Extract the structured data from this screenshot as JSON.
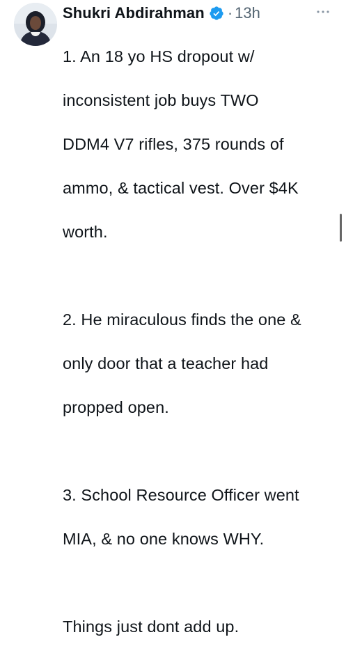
{
  "tweet": {
    "author_name": "Shukri Abdirahman",
    "verified": true,
    "verified_icon": "verified-badge-icon",
    "separator": "·",
    "timestamp": "13h",
    "more_icon": "more-dots-icon",
    "avatar_icon": "avatar-photo",
    "body_lines": [
      "1. An 18 yo HS dropout w/",
      "inconsistent job buys TWO",
      "DDM4 V7 rifles, 375 rounds of",
      "ammo, & tactical vest. Over $4K",
      "worth.",
      "",
      "2. He miraculous finds the one &",
      "only door that a teacher had",
      "propped open.",
      "",
      "3. School Resource Officer went",
      "MIA, & no one knows WHY.",
      "",
      "Things just dont add up."
    ]
  },
  "colors": {
    "text_primary": "#0f1419",
    "text_secondary": "#536471",
    "verified_blue": "#1d9bf0",
    "background": "#ffffff"
  }
}
